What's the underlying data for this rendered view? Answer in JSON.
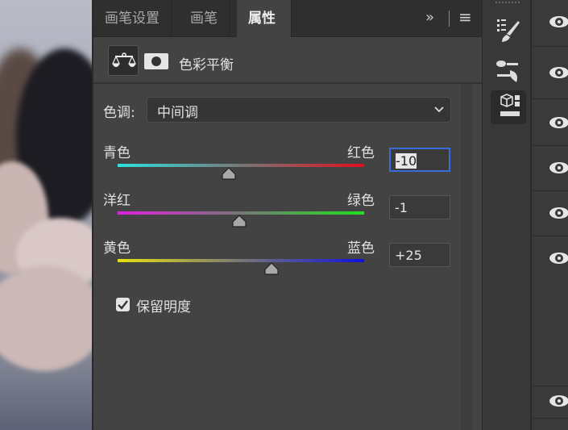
{
  "tabs": [
    {
      "label": "画笔设置"
    },
    {
      "label": "画笔"
    },
    {
      "label": "属性",
      "active": true
    }
  ],
  "tab_actions": {
    "collapse": "»",
    "menu": "≡"
  },
  "header": {
    "adjustment_icon": "scale-balance-icon",
    "mask_icon": "layer-mask-icon",
    "title": "色彩平衡"
  },
  "tone": {
    "label": "色调:",
    "value": "中间调"
  },
  "sliders": [
    {
      "left": "青色",
      "right": "红色",
      "value": "-10",
      "numeric": -10,
      "colors": [
        "#2fe0e0",
        "#e0101e"
      ],
      "focused": true
    },
    {
      "left": "洋红",
      "right": "绿色",
      "value": "-1",
      "numeric": -1,
      "colors": [
        "#e020e0",
        "#20e020"
      ]
    },
    {
      "left": "黄色",
      "right": "蓝色",
      "value": "+25",
      "numeric": 25,
      "colors": [
        "#e8e010",
        "#1010e0"
      ]
    }
  ],
  "range": [
    -100,
    100
  ],
  "preserve_luminosity": {
    "label": "保留明度",
    "checked": true
  },
  "toolbar": [
    "brush-presets-icon",
    "brush-settings-icon",
    "properties-icon"
  ],
  "layer_visibility_count": 7
}
